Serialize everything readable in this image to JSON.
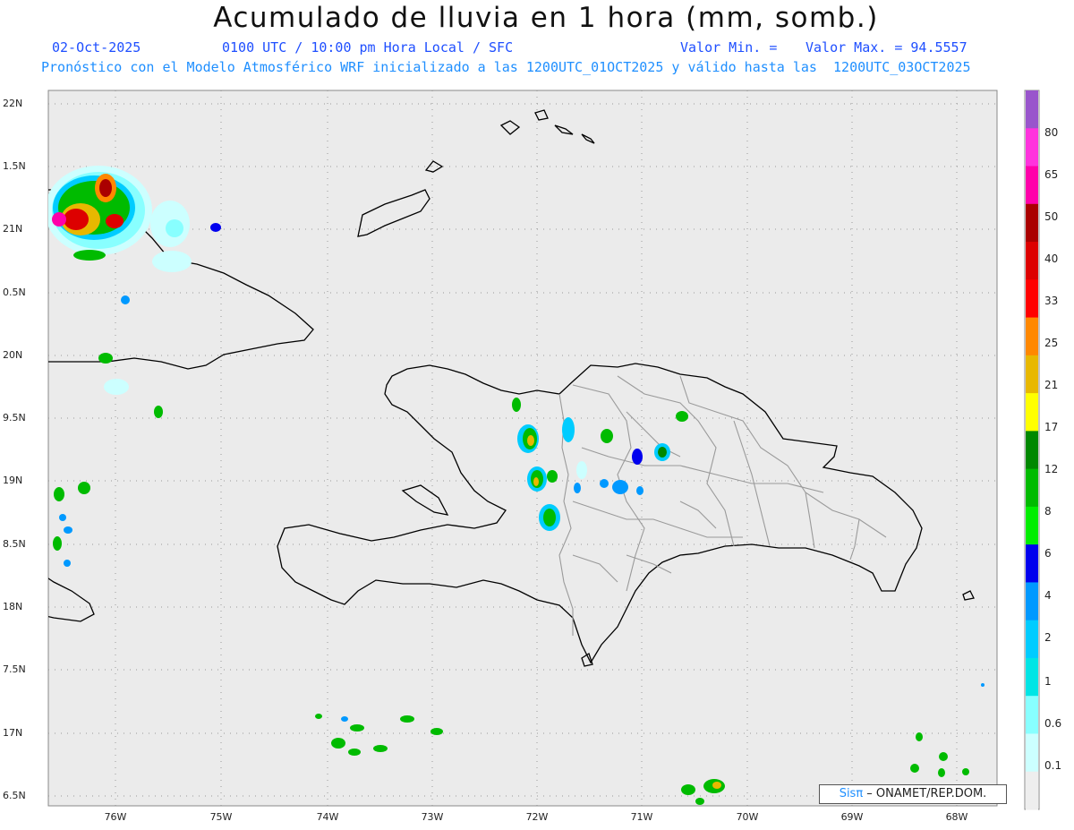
{
  "header": {
    "title": "Acumulado de lluvia en 1 hora (mm, somb.)",
    "date": "02-Oct-2025",
    "time": "0100 UTC / 10:00 pm Hora Local / SFC",
    "min_label": "Valor Min. =",
    "max_label": "Valor Max. = 94.5557",
    "description": "Pronóstico con el Modelo Atmosférico WRF inicializado a las 1200UTC_01OCT2025 y válido hasta las  1200UTC_03OCT2025"
  },
  "axes": {
    "lat_labels": [
      "22N",
      "1.5N",
      "21N",
      "0.5N",
      "20N",
      "9.5N",
      "19N",
      "8.5N",
      "18N",
      "7.5N",
      "17N",
      "6.5N"
    ],
    "lon_labels": [
      "76W",
      "75W",
      "74W",
      "73W",
      "72W",
      "71W",
      "70W",
      "69W",
      "68W"
    ]
  },
  "colorbar": {
    "labels": [
      "80",
      "65",
      "50",
      "40",
      "33",
      "25",
      "21",
      "17",
      "12",
      "8",
      "6",
      "4",
      "2",
      "1",
      "0.6",
      "0.1"
    ],
    "colors": [
      "#9955cc",
      "#ff33dd",
      "#ff00aa",
      "#aa0000",
      "#dd0000",
      "#ff0000",
      "#ff8800",
      "#e8b800",
      "#ffff00",
      "#008800",
      "#00bb00",
      "#00ee00",
      "#0000ee",
      "#0099ff",
      "#00ccff",
      "#00e5e5",
      "#88ffff",
      "#ccffff",
      "#eeeeee"
    ]
  },
  "credit": {
    "brand": "Sisπ",
    "org": " – ONAMET/REP.DOM."
  }
}
